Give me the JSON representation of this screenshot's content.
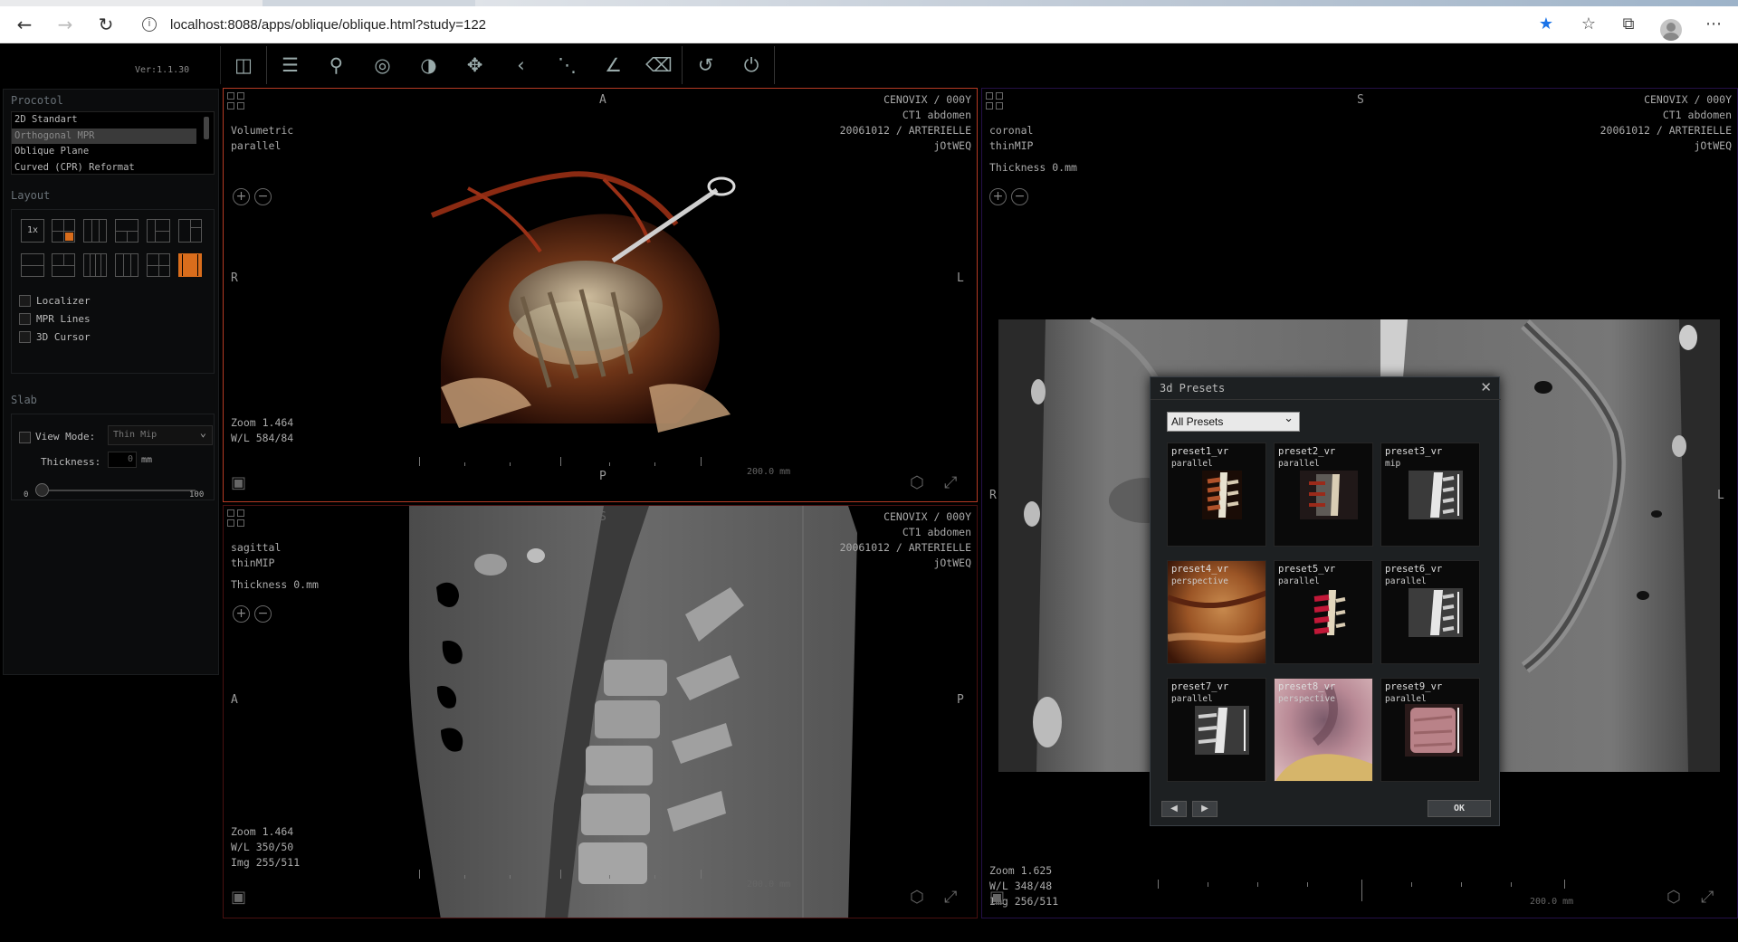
{
  "browser": {
    "url": "localhost:8088/apps/oblique/oblique.html?study=122",
    "back_icon": "arrow-left-icon",
    "forward_icon": "arrow-right-icon",
    "reload_icon": "reload-icon"
  },
  "app": {
    "version": "Ver:1.1.30",
    "toolbar": [
      "cube-icon",
      "menu-icon",
      "search-icon",
      "crosshair-icon",
      "contrast-icon",
      "move-icon",
      "chevron-left-icon",
      "measure-dotted-icon",
      "angle-icon",
      "eraser-icon",
      "undo-icon",
      "power-icon"
    ]
  },
  "left_panel": {
    "protocol": {
      "title": "Procotol",
      "items": [
        "2D Standart",
        "Orthogonal MPR",
        "Oblique Plane",
        "Curved (CPR) Reformat"
      ],
      "selected_index": 1
    },
    "layout": {
      "title": "Layout",
      "one_label": "1x",
      "options": [
        {
          "label": "Localizer"
        },
        {
          "label": "MPR Lines"
        },
        {
          "label": "3D Cursor"
        }
      ]
    },
    "slab": {
      "title": "Slab",
      "view_mode_label": "View Mode:",
      "view_mode_value": "Thin Mip",
      "thickness_label": "Thickness:",
      "thickness_value": "0",
      "thickness_unit": "mm",
      "slider_min": "0",
      "slider_max": "100",
      "slider_value": 0
    }
  },
  "viewports": {
    "volumetric": {
      "orient_top": "A",
      "orient_left": "R",
      "orient_right": "L",
      "orient_bottom": "P",
      "patient": "CENOVIX  / 000Y",
      "study": "CT1 abdomen",
      "series": "20061012 / ARTERIELLE",
      "id": "jOtWEQ",
      "view": "Volumetric",
      "projection": "parallel",
      "zoom": "Zoom 1.464",
      "wl": "W/L 584/84",
      "scale": "200.0 mm"
    },
    "sagittal": {
      "orient_top": "S",
      "orient_left": "A",
      "orient_right": "P",
      "patient": "CENOVIX  / 000Y",
      "study": "CT1 abdomen",
      "series": "20061012 / ARTERIELLE",
      "id": "jOtWEQ",
      "view": "sagittal",
      "projection": "thinMIP",
      "thickness": "Thickness 0.mm",
      "zoom": "Zoom 1.464",
      "wl": "W/L 350/50",
      "img": "Img 255/511",
      "scale": "200.0 mm"
    },
    "coronal": {
      "orient_top": "S",
      "orient_left": "R",
      "orient_right": "L",
      "patient": "CENOVIX  / 000Y",
      "study": "CT1 abdomen",
      "series": "20061012 / ARTERIELLE",
      "id": "jOtWEQ",
      "view": "coronal",
      "projection": "thinMIP",
      "thickness": "Thickness 0.mm",
      "zoom": "Zoom 1.625",
      "wl": "W/L 348/48",
      "img": "Img 256/511",
      "scale": "200.0 mm"
    }
  },
  "dialog": {
    "title": "3d Presets",
    "filter": "All Presets",
    "ok_label": "OK",
    "presets": [
      {
        "name": "preset1_vr",
        "type": "parallel"
      },
      {
        "name": "preset2_vr",
        "type": "parallel"
      },
      {
        "name": "preset3_vr",
        "type": "mip"
      },
      {
        "name": "preset4_vr",
        "type": "perspective"
      },
      {
        "name": "preset5_vr",
        "type": "parallel"
      },
      {
        "name": "preset6_vr",
        "type": "parallel"
      },
      {
        "name": "preset7_vr",
        "type": "parallel"
      },
      {
        "name": "preset8_vr",
        "type": "perspective"
      },
      {
        "name": "preset9_vr",
        "type": "parallel"
      }
    ]
  },
  "colors": {
    "accent": "#d96d1c",
    "active_viewport_border": "#b53a24",
    "background": "#000000"
  }
}
